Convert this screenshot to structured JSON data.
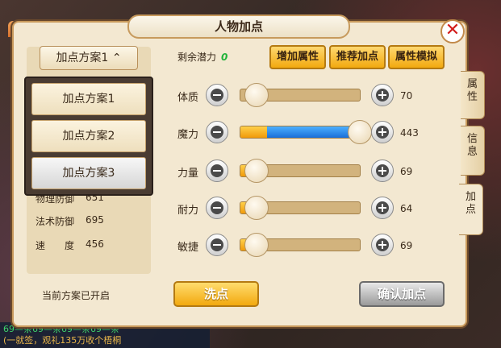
{
  "title": "人物加点",
  "close_label": "✕",
  "plan_toggle": {
    "label": "加点方案1",
    "arrow": "⌃"
  },
  "plans": [
    "加点方案1",
    "加点方案2",
    "加点方案3"
  ],
  "selected_plan": 2,
  "stats": [
    {
      "label": "物理防御",
      "value": "651"
    },
    {
      "label": "法术防御",
      "value": "695"
    },
    {
      "label": "速　　度",
      "value": "456"
    }
  ],
  "current_plan_msg": "当前方案已开启",
  "potential": {
    "label": "剩余潜力",
    "value": "0"
  },
  "top_buttons": [
    "增加属性",
    "推荐加点",
    "属性模拟"
  ],
  "attributes": [
    {
      "label": "体质",
      "value": "70",
      "fill": 0.0
    },
    {
      "label": "魔力",
      "value": "443",
      "fill": 1.0,
      "base_fill": 0.22
    },
    {
      "label": "力量",
      "value": "69",
      "fill": 0.0
    },
    {
      "label": "耐力",
      "value": "64",
      "fill": 0.0
    },
    {
      "label": "敏捷",
      "value": "69",
      "fill": 0.0
    }
  ],
  "wash_label": "洗点",
  "confirm_label": "确认加点",
  "side_tabs": [
    "属性",
    "信息",
    "加点"
  ],
  "active_side_tab": 2,
  "chat_lines": [
    "69—条69—条69—条69—条",
    "(一就签，观礼135万收个梧桐"
  ],
  "colors": {
    "accent_orange": "#f2a90f",
    "blue_fill": "#1a6fd8",
    "potential_green": "#21b33a",
    "close_red": "#d21c1c"
  }
}
